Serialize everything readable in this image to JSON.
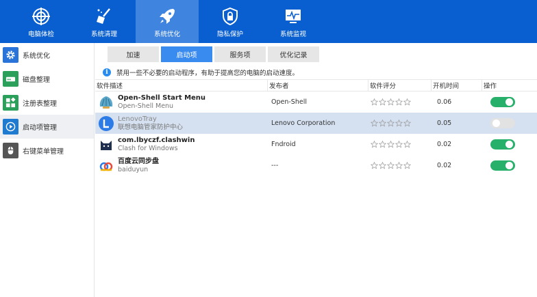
{
  "topnav": {
    "tabs": [
      {
        "label": "电脑体检",
        "icon": "target-icon"
      },
      {
        "label": "系统清理",
        "icon": "broom-icon"
      },
      {
        "label": "系统优化",
        "icon": "rocket-icon",
        "active": true
      },
      {
        "label": "隐私保护",
        "icon": "shield-lock-icon"
      },
      {
        "label": "系统监视",
        "icon": "monitor-icon"
      }
    ]
  },
  "sidebar": {
    "items": [
      {
        "label": "系统优化",
        "icon": "gear-icon",
        "color": "#2a73d8"
      },
      {
        "label": "磁盘整理",
        "icon": "disk-icon",
        "color": "#2aa05a"
      },
      {
        "label": "注册表整理",
        "icon": "blocks-icon",
        "color": "#2aa05a"
      },
      {
        "label": "启动项管理",
        "icon": "play-icon",
        "color": "#1f7bd0",
        "active": true
      },
      {
        "label": "右键菜单管理",
        "icon": "mouse-icon",
        "color": "#555555"
      }
    ]
  },
  "subtabs": [
    {
      "label": "加速"
    },
    {
      "label": "启动项",
      "active": true
    },
    {
      "label": "服务项"
    },
    {
      "label": "优化记录"
    }
  ],
  "notice": {
    "icon": "info-icon",
    "text": "禁用一些不必要的启动程序，有助于提高您的电脑的启动速度。"
  },
  "table": {
    "headers": {
      "desc": "软件描述",
      "publisher": "发布者",
      "rating": "软件评分",
      "boot_time": "开机时间",
      "action": "操作"
    },
    "rows": [
      {
        "name": "Open-Shell Start Menu",
        "sub": "Open-Shell Menu",
        "publisher": "Open-Shell",
        "time": "0.06",
        "enabled": true,
        "icon": "shell-icon"
      },
      {
        "name": "LenovoTray",
        "sub": "联想电脑管家防护中心",
        "publisher": "Lenovo Corporation",
        "time": "0.05",
        "enabled": false,
        "icon": "lenovo-icon",
        "selected": true
      },
      {
        "name": "com.lbyczf.clashwin",
        "sub": "Clash for Windows",
        "publisher": "Fndroid",
        "time": "0.02",
        "enabled": true,
        "icon": "cat-icon"
      },
      {
        "name": "百度云同步盘",
        "sub": "baiduyun",
        "publisher": "---",
        "time": "0.02",
        "enabled": true,
        "icon": "baidu-cloud-icon"
      }
    ]
  },
  "colors": {
    "topbar": "#0a5fd0",
    "active_tab": "#3f84df",
    "accent": "#3a8bf0",
    "toggle_on": "#26b06a"
  }
}
